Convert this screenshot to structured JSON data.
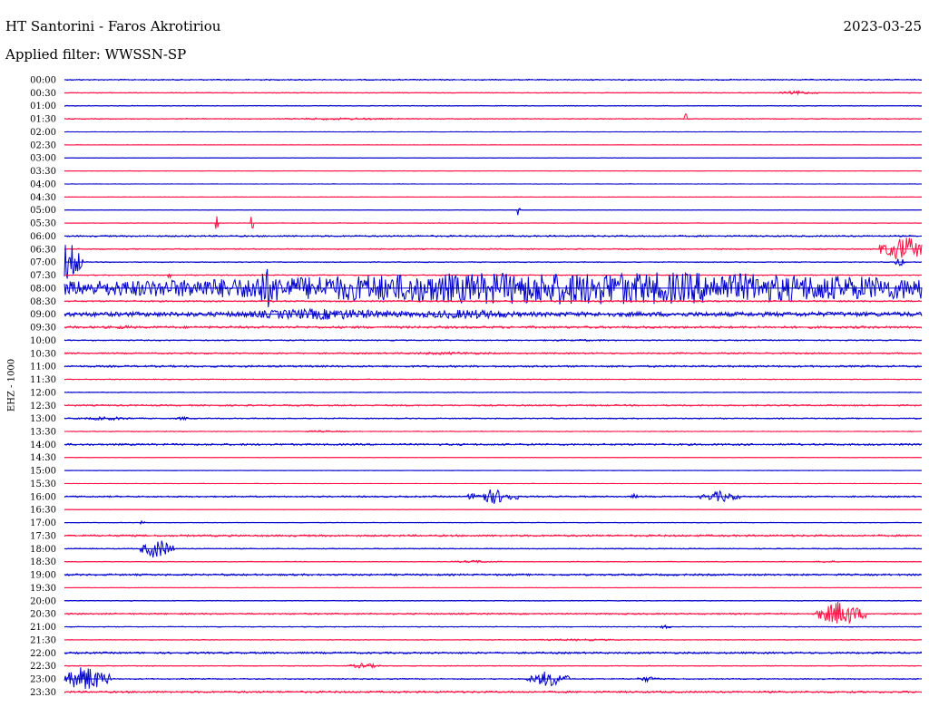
{
  "header": {
    "title": "HT Santorini - Faros Akrotiriou",
    "date": "2023-03-25",
    "filter": "Applied filter: WWSSN-SP"
  },
  "chart_data": {
    "type": "line",
    "title": "HT Santorini - Faros Akrotiriou",
    "subtitle": "Applied filter: WWSSN-SP",
    "ylabel": "EHZ - 1000",
    "xlabel": "",
    "row_colors": [
      "#0000cc",
      "#ff1144"
    ],
    "rows": [
      {
        "label": "00:00",
        "noise": 0.6,
        "bursts": []
      },
      {
        "label": "00:30",
        "noise": 0.4,
        "bursts": [
          {
            "x": 0.855,
            "amp": 2,
            "width": 0.025
          }
        ]
      },
      {
        "label": "01:00",
        "noise": 0.4,
        "bursts": []
      },
      {
        "label": "01:30",
        "noise": 0.5,
        "bursts": [
          {
            "x": 0.725,
            "amp": 7,
            "width": 0.002
          },
          {
            "x": 0.32,
            "amp": 1.2,
            "width": 0.1
          }
        ]
      },
      {
        "label": "02:00",
        "noise": 0.2,
        "bursts": []
      },
      {
        "label": "02:30",
        "noise": 0.2,
        "bursts": []
      },
      {
        "label": "03:00",
        "noise": 0.2,
        "bursts": []
      },
      {
        "label": "03:30",
        "noise": 0.2,
        "bursts": []
      },
      {
        "label": "04:00",
        "noise": 0.2,
        "bursts": []
      },
      {
        "label": "04:30",
        "noise": 0.2,
        "bursts": []
      },
      {
        "label": "05:00",
        "noise": 0.2,
        "bursts": [
          {
            "x": 0.53,
            "amp": 12,
            "width": 0.002
          }
        ]
      },
      {
        "label": "05:30",
        "noise": 0.3,
        "bursts": [
          {
            "x": 0.178,
            "amp": 16,
            "width": 0.002
          },
          {
            "x": 0.219,
            "amp": 16,
            "width": 0.002
          }
        ]
      },
      {
        "label": "06:00",
        "noise": 0.8,
        "bursts": []
      },
      {
        "label": "06:30",
        "noise": 0.6,
        "bursts": [
          {
            "x": 0.98,
            "amp": 14,
            "width": 0.03
          }
        ]
      },
      {
        "label": "07:00",
        "noise": 0.5,
        "bursts": [
          {
            "x": 0.005,
            "amp": 22,
            "width": 0.018
          },
          {
            "x": 0.974,
            "amp": 6,
            "width": 0.006
          }
        ]
      },
      {
        "label": "07:30",
        "noise": 0.5,
        "bursts": [
          {
            "x": 0.122,
            "amp": 6,
            "width": 0.002
          }
        ]
      },
      {
        "label": "08:00",
        "noise": 0.6,
        "bursts": [
          {
            "x": 0.235,
            "amp": 22,
            "width": 0.03
          },
          {
            "x": 0.61,
            "amp": 18,
            "width": 0.78
          }
        ]
      },
      {
        "label": "08:30",
        "noise": 0.8,
        "bursts": []
      },
      {
        "label": "09:00",
        "noise": 2.5,
        "bursts": [
          {
            "x": 0.3,
            "amp": 6,
            "width": 0.15
          },
          {
            "x": 0.47,
            "amp": 5,
            "width": 0.1
          }
        ]
      },
      {
        "label": "09:30",
        "noise": 1.2,
        "bursts": [
          {
            "x": 0.07,
            "amp": 2,
            "width": 0.02
          }
        ]
      },
      {
        "label": "10:00",
        "noise": 0.6,
        "bursts": [
          {
            "x": 0.6,
            "amp": 1,
            "width": 0.1
          }
        ]
      },
      {
        "label": "10:30",
        "noise": 0.8,
        "bursts": [
          {
            "x": 0.45,
            "amp": 1.5,
            "width": 0.1
          }
        ]
      },
      {
        "label": "11:00",
        "noise": 1.0,
        "bursts": []
      },
      {
        "label": "11:30",
        "noise": 0.4,
        "bursts": []
      },
      {
        "label": "12:00",
        "noise": 0.4,
        "bursts": []
      },
      {
        "label": "12:30",
        "noise": 0.8,
        "bursts": []
      },
      {
        "label": "13:00",
        "noise": 0.6,
        "bursts": [
          {
            "x": 0.05,
            "amp": 2,
            "width": 0.04
          },
          {
            "x": 0.138,
            "amp": 2,
            "width": 0.01
          }
        ]
      },
      {
        "label": "13:30",
        "noise": 0.4,
        "bursts": [
          {
            "x": 0.3,
            "amp": 1,
            "width": 0.05
          }
        ]
      },
      {
        "label": "14:00",
        "noise": 1.0,
        "bursts": []
      },
      {
        "label": "14:30",
        "noise": 0.2,
        "bursts": []
      },
      {
        "label": "15:00",
        "noise": 0.2,
        "bursts": []
      },
      {
        "label": "15:30",
        "noise": 0.2,
        "bursts": []
      },
      {
        "label": "16:00",
        "noise": 0.8,
        "bursts": [
          {
            "x": 0.5,
            "amp": 8,
            "width": 0.03
          },
          {
            "x": 0.765,
            "amp": 6,
            "width": 0.025
          },
          {
            "x": 0.665,
            "amp": 3,
            "width": 0.005
          }
        ]
      },
      {
        "label": "16:30",
        "noise": 0.2,
        "bursts": []
      },
      {
        "label": "17:00",
        "noise": 0.3,
        "bursts": [
          {
            "x": 0.09,
            "amp": 2,
            "width": 0.004
          }
        ]
      },
      {
        "label": "17:30",
        "noise": 1.0,
        "bursts": []
      },
      {
        "label": "18:00",
        "noise": 0.5,
        "bursts": [
          {
            "x": 0.108,
            "amp": 11,
            "width": 0.02
          }
        ]
      },
      {
        "label": "18:30",
        "noise": 0.4,
        "bursts": [
          {
            "x": 0.48,
            "amp": 1.5,
            "width": 0.03
          },
          {
            "x": 0.89,
            "amp": 1.2,
            "width": 0.02
          }
        ]
      },
      {
        "label": "19:00",
        "noise": 1.0,
        "bursts": []
      },
      {
        "label": "19:30",
        "noise": 0.2,
        "bursts": []
      },
      {
        "label": "20:00",
        "noise": 0.4,
        "bursts": []
      },
      {
        "label": "20:30",
        "noise": 0.8,
        "bursts": [
          {
            "x": 0.905,
            "amp": 14,
            "width": 0.03
          }
        ]
      },
      {
        "label": "21:00",
        "noise": 0.4,
        "bursts": [
          {
            "x": 0.7,
            "amp": 2,
            "width": 0.01
          }
        ]
      },
      {
        "label": "21:30",
        "noise": 0.4,
        "bursts": [
          {
            "x": 0.6,
            "amp": 1,
            "width": 0.1
          }
        ]
      },
      {
        "label": "22:00",
        "noise": 1.0,
        "bursts": []
      },
      {
        "label": "22:30",
        "noise": 0.4,
        "bursts": [
          {
            "x": 0.35,
            "amp": 3,
            "width": 0.02
          }
        ]
      },
      {
        "label": "23:00",
        "noise": 0.6,
        "bursts": [
          {
            "x": 0.025,
            "amp": 14,
            "width": 0.03
          },
          {
            "x": 0.565,
            "amp": 9,
            "width": 0.025
          },
          {
            "x": 0.68,
            "amp": 3,
            "width": 0.015
          }
        ]
      },
      {
        "label": "23:30",
        "noise": 1.0,
        "bursts": []
      }
    ]
  }
}
